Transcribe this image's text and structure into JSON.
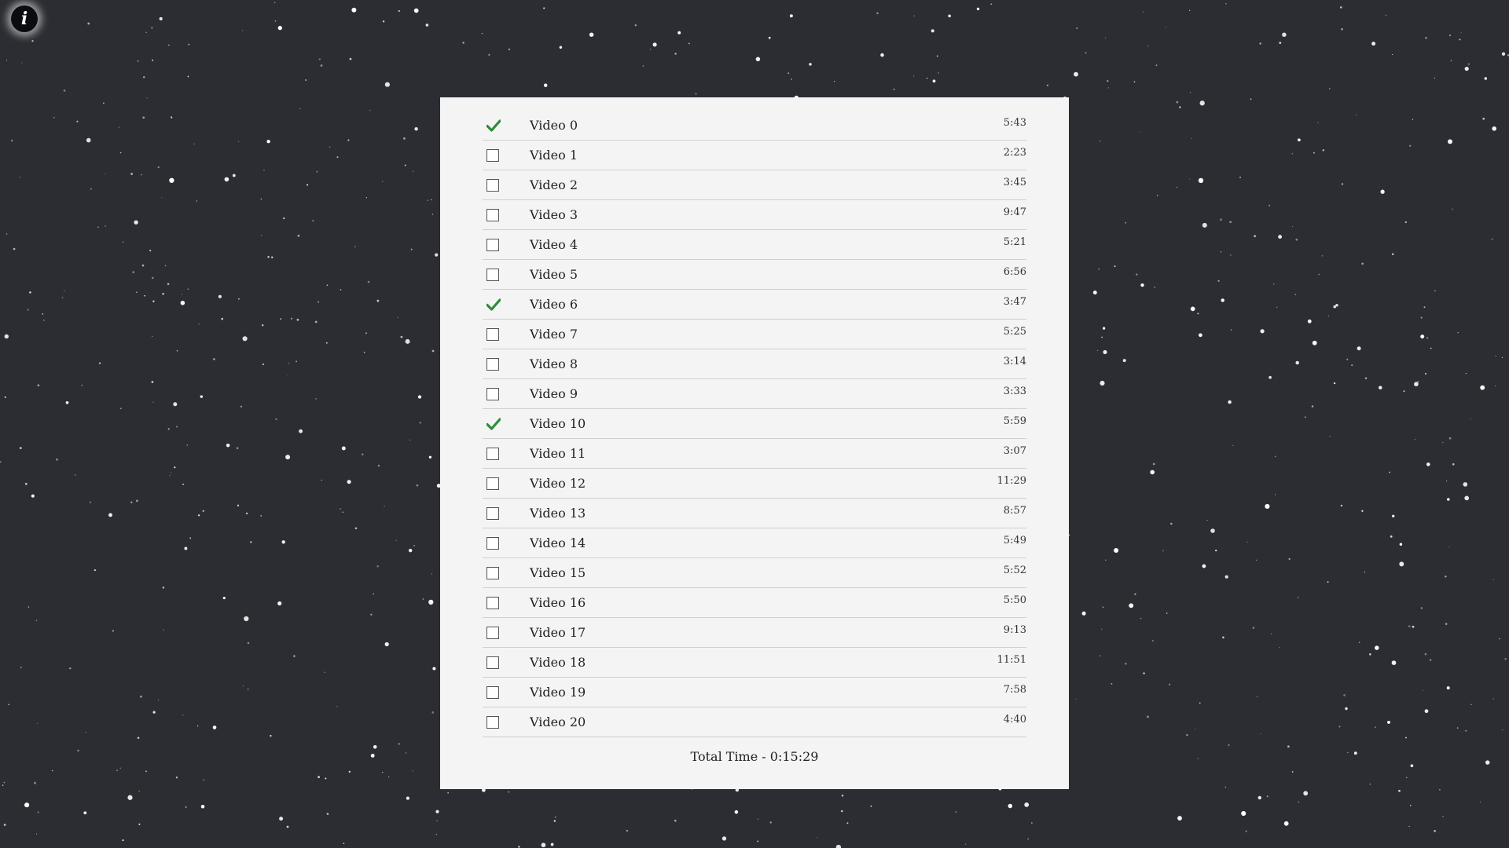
{
  "info_button": {
    "icon": "info-icon",
    "label": "i"
  },
  "colors": {
    "background": "#2b2d33",
    "panel": "#f4f4f4",
    "check": "#2e8b3a"
  },
  "videos": [
    {
      "title": "Video 0",
      "duration": "5:43",
      "watched": true
    },
    {
      "title": "Video 1",
      "duration": "2:23",
      "watched": false
    },
    {
      "title": "Video 2",
      "duration": "3:45",
      "watched": false
    },
    {
      "title": "Video 3",
      "duration": "9:47",
      "watched": false
    },
    {
      "title": "Video 4",
      "duration": "5:21",
      "watched": false
    },
    {
      "title": "Video 5",
      "duration": "6:56",
      "watched": false
    },
    {
      "title": "Video 6",
      "duration": "3:47",
      "watched": true
    },
    {
      "title": "Video 7",
      "duration": "5:25",
      "watched": false
    },
    {
      "title": "Video 8",
      "duration": "3:14",
      "watched": false
    },
    {
      "title": "Video 9",
      "duration": "3:33",
      "watched": false
    },
    {
      "title": "Video 10",
      "duration": "5:59",
      "watched": true
    },
    {
      "title": "Video 11",
      "duration": "3:07",
      "watched": false
    },
    {
      "title": "Video 12",
      "duration": "11:29",
      "watched": false
    },
    {
      "title": "Video 13",
      "duration": "8:57",
      "watched": false
    },
    {
      "title": "Video 14",
      "duration": "5:49",
      "watched": false
    },
    {
      "title": "Video 15",
      "duration": "5:52",
      "watched": false
    },
    {
      "title": "Video 16",
      "duration": "5:50",
      "watched": false
    },
    {
      "title": "Video 17",
      "duration": "9:13",
      "watched": false
    },
    {
      "title": "Video 18",
      "duration": "11:51",
      "watched": false
    },
    {
      "title": "Video 19",
      "duration": "7:58",
      "watched": false
    },
    {
      "title": "Video 20",
      "duration": "4:40",
      "watched": false
    }
  ],
  "total_time": "Total Time - 0:15:29"
}
